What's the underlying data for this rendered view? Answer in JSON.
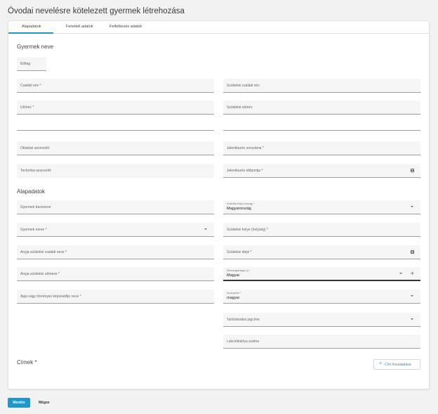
{
  "page": {
    "title": "Óvodai nevelésre kötelezett gyermek létrehozása"
  },
  "tabs": [
    "Alapadatok",
    "Felvételi adatok",
    "Felfelbezés adatok"
  ],
  "sections": {
    "name": "Gyermek neve",
    "basic": "Alapadatok",
    "address": "Címek *"
  },
  "fields": {
    "elotag": "Előtag",
    "csaladi_nev": "Családi név *",
    "szuletesi_csaladi_nev": "Születési családi név",
    "utonev": "Utónév *",
    "szuletesi_utonev": "Születési utónév",
    "oktatasi_azonosito": "Oktatási azonosító",
    "jelentkezes_sorszama": "Jelentkezés sorszáma *",
    "technikai_azonosito": "Technikai azonosító",
    "jelentkezes_idopontja": "Jelentkezés időpontja *",
    "becenev": "Gyermek beceneve",
    "szuletesi_hely_orszag_label": "Születési helye (ország) *",
    "szuletesi_hely_orszag_value": "Magyarország",
    "neme": "Gyermek neme *",
    "szuletesi_hely_helyseg": "Születési helye (helység) *",
    "anyja_csaladi_nev": "Anyja születési családi neve *",
    "szuletesi_ideje": "Születési ideje *",
    "anyja_utoneve": "Anyja születési utóneve *",
    "allampolgarsaga_label": "Állampolgársága (1) *",
    "allampolgarsaga_value": "Magyar",
    "torvenyes_kepviselo": "Apja vagy törvényes képviselője neve *",
    "anyanyelve_label": "Anyanyelve *",
    "anyanyelve_value": "magyar",
    "tartozkodasi_jogcime": "Tartózkodási jogcíme",
    "lakcimkartya_szama": "Lakcímkártya száma"
  },
  "buttons": {
    "add_address": "Cím hozzáadása",
    "save": "Mentés",
    "cancel": "Mégse"
  }
}
